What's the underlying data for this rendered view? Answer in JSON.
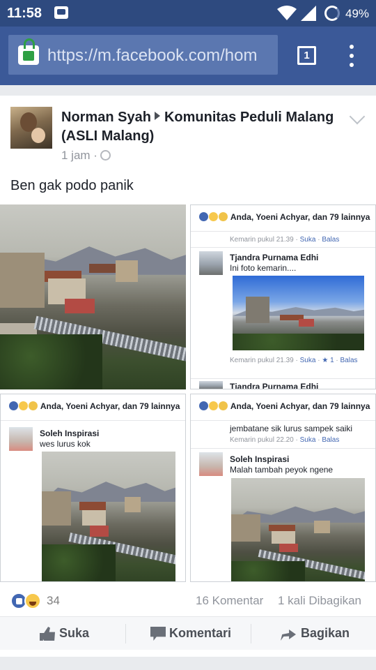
{
  "status_bar": {
    "time": "11:58",
    "battery": "49%"
  },
  "browser": {
    "url": "https://m.facebook.com/hom",
    "tab_count": "1"
  },
  "post": {
    "author": "Norman Syah",
    "group": "Komunitas Peduli Malang (ASLI Malang)",
    "time": "1 jam ·",
    "text": "Ben gak podo panik",
    "reaction_count": "34",
    "comments": "16 Komentar",
    "shares": "1 kali Dibagikan"
  },
  "screenshots": {
    "s2": {
      "header": "Anda, Yoeni Achyar, dan 79 lainnya",
      "meta1": "Kemarin pukul 21.39",
      "meta1_like": "Suka",
      "meta1_reply": "Balas",
      "name": "Tjandra Purnama Edhi",
      "comment": "Ini foto kemarin....",
      "meta2": "Kemarin pukul 21.39",
      "meta2_like": "Suka",
      "meta2_count": "1",
      "meta2_reply": "Balas",
      "name2": "Tjandra Purnama Edhi"
    },
    "s3": {
      "header": "Anda, Yoeni Achyar, dan 79 lainnya",
      "name": "Soleh Inspirasi",
      "comment": "wes lurus kok"
    },
    "s4": {
      "header": "Anda, Yoeni Achyar, dan 79 lainnya",
      "comment_top": "jembatane sik lurus sampek saiki",
      "meta": "Kemarin pukul 22.20",
      "meta_like": "Suka",
      "meta_reply": "Balas",
      "name": "Soleh Inspirasi",
      "comment": "Malah tambah peyok ngene"
    }
  },
  "actions": {
    "like": "Suka",
    "comment": "Komentari",
    "share": "Bagikan"
  }
}
